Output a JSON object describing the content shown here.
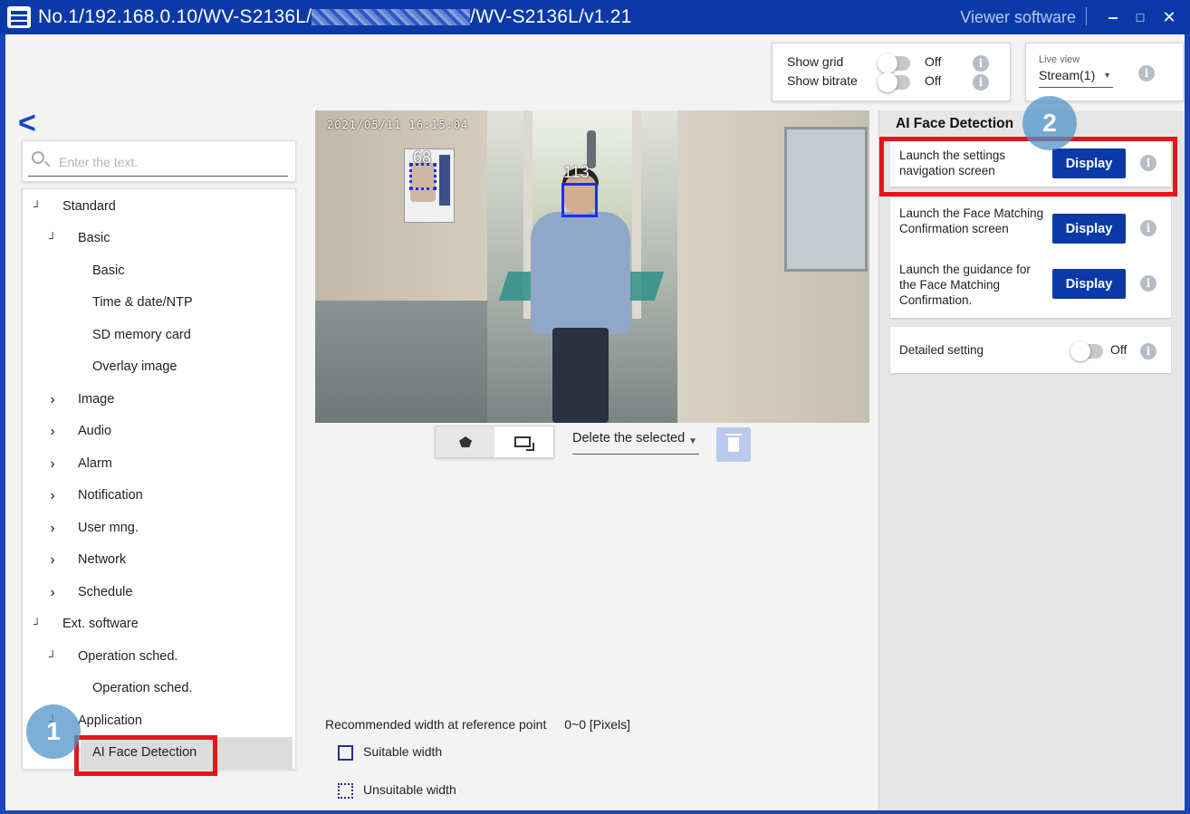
{
  "window": {
    "title_prefix": "No.1/192.168.0.10/WV-S2136L/",
    "title_suffix": "/WV-S2136L/v1.21",
    "product": "Viewer software",
    "minimize": "‒",
    "maximize": "□",
    "close": "✕"
  },
  "top_controls": {
    "show_grid": {
      "label": "Show grid",
      "state": "Off"
    },
    "show_bitrate": {
      "label": "Show bitrate",
      "state": "Off"
    },
    "live_view": {
      "label": "Live view",
      "value": "Stream(1)"
    }
  },
  "search": {
    "placeholder": "Enter the text."
  },
  "menu": [
    {
      "label": "Standard",
      "arrow": "┘"
    },
    {
      "label": "Basic",
      "arrow": "┘"
    },
    {
      "label": "Basic"
    },
    {
      "label": "Time & date/NTP"
    },
    {
      "label": "SD memory card"
    },
    {
      "label": "Overlay image"
    },
    {
      "label": "Image",
      "arrow": "›"
    },
    {
      "label": "Audio",
      "arrow": "›"
    },
    {
      "label": "Alarm",
      "arrow": "›"
    },
    {
      "label": "Notification",
      "arrow": "›"
    },
    {
      "label": "User mng.",
      "arrow": "›"
    },
    {
      "label": "Network",
      "arrow": "›"
    },
    {
      "label": "Schedule",
      "arrow": "›"
    },
    {
      "label": "Ext. software",
      "arrow": "┘"
    },
    {
      "label": "Operation sched.",
      "arrow": "┘"
    },
    {
      "label": "Operation sched."
    },
    {
      "label": "Application",
      "arrow": "┘"
    },
    {
      "label": "AI Face Detection",
      "selected": true
    }
  ],
  "camera": {
    "timestamp": "2021/05/11 16:15:04",
    "face_a_label": "68",
    "face_b_label": "113"
  },
  "toolbar": {
    "delete_select": "Delete the selected"
  },
  "reference": {
    "label": "Recommended width at reference point",
    "value": "0~0 [Pixels]",
    "suitable": "Suitable width",
    "unsuitable": "Unsuitable width"
  },
  "panel": {
    "title": "AI Face Detection",
    "launch_nav": "Launch the settings navigation screen",
    "launch_match": "Launch the Face Matching Confirmation screen",
    "launch_guide": "Launch the guidance for the Face Matching Confirmation.",
    "display_label": "Display",
    "detailed": {
      "label": "Detailed setting",
      "state": "Off"
    }
  },
  "annotations": {
    "step1": "1",
    "step2": "2"
  },
  "colors": {
    "titlebar": "#0b3aa8",
    "accent": "#0b3aa8",
    "highlight": "#e8141b",
    "face_box": "#1a2ff0"
  }
}
